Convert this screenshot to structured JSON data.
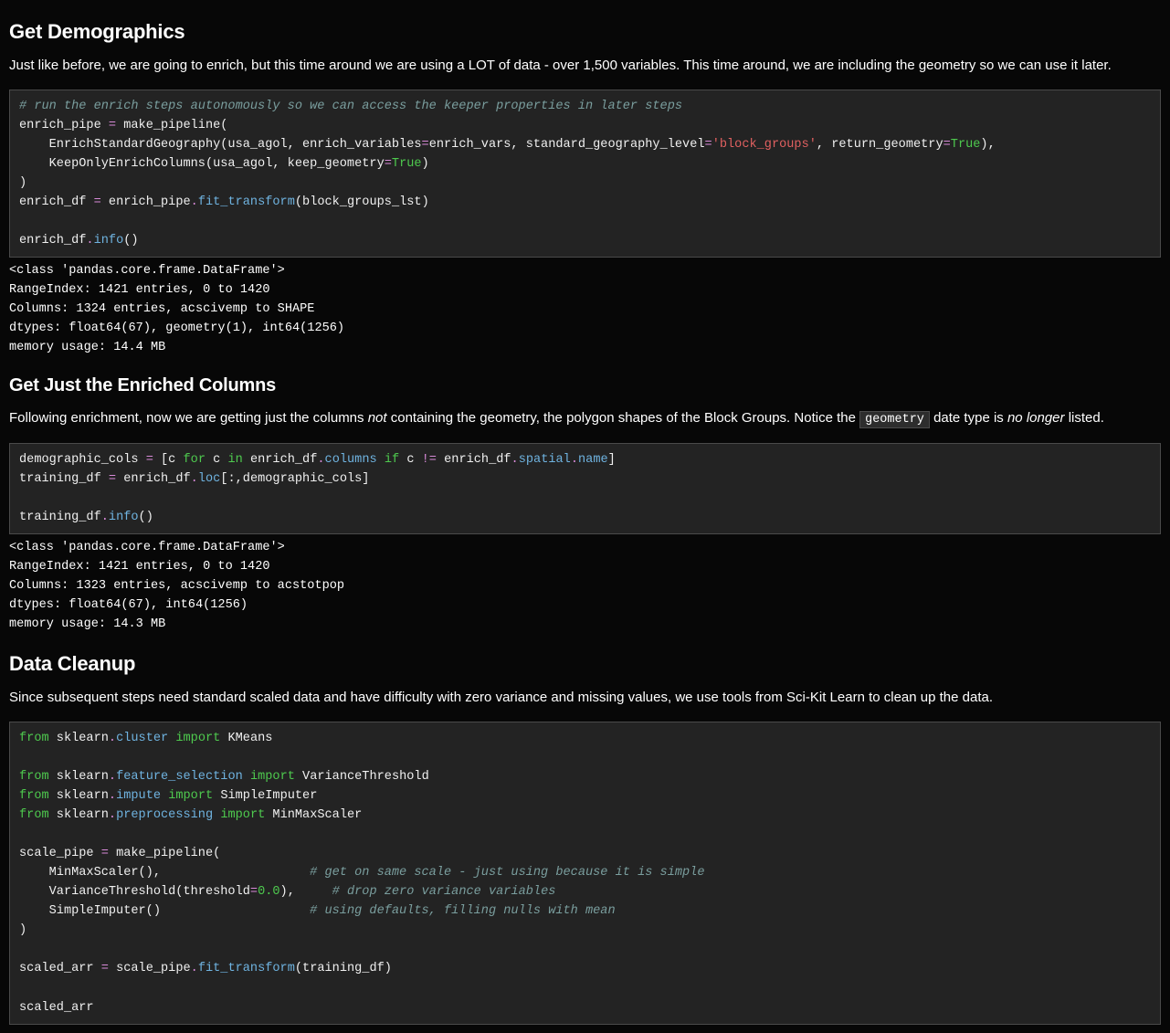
{
  "sections": {
    "demographics": {
      "heading": "Get Demographics",
      "prose": "Just like before, we are going to enrich, but this time around we are using a LOT of data - over 1,500 variables. This time around, we are including the geometry so we can use it later."
    },
    "enriched_cols": {
      "heading": "Get Just the Enriched Columns",
      "prose_pre": "Following enrichment, now we are getting just the columns ",
      "prose_em1": "not",
      "prose_mid": " containing the geometry, the polygon shapes of the Block Groups. Notice the ",
      "prose_code": "geometry",
      "prose_post1": " date type is ",
      "prose_em2": "no longer",
      "prose_post2": " listed."
    },
    "cleanup": {
      "heading": "Data Cleanup",
      "prose": "Since subsequent steps need standard scaled data and have difficulty with zero variance and missing values, we use tools from Sci-Kit Learn to clean up the data."
    }
  },
  "code": {
    "c1_comment": "# run the enrich steps autonomously so we can access the keeper properties in later steps",
    "c1_l1a": "enrich_pipe ",
    "c1_l1b": " make_pipeline(",
    "c1_l2a": "    EnrichStandardGeography(usa_agol, enrich_variables",
    "c1_l2b": "enrich_vars, standard_geography_level",
    "c1_l2c": "'block_groups'",
    "c1_l2d": ", return_geometry",
    "c1_l2e": "True",
    "c1_l2f": "),",
    "c1_l3a": "    KeepOnlyEnrichColumns(usa_agol, keep_geometry",
    "c1_l3b": "True",
    "c1_l3c": ")",
    "c1_l4": ")",
    "c1_l5a": "enrich_df ",
    "c1_l5b": " enrich_pipe",
    "c1_l5c": "fit_transform",
    "c1_l5d": "(block_groups_lst)",
    "c1_l6a": "enrich_df",
    "c1_l6b": "info",
    "c1_l6c": "()",
    "out1_l1": "<class 'pandas.core.frame.DataFrame'>",
    "out1_l2": "RangeIndex: 1421 entries, 0 to 1420",
    "out1_l3": "Columns: 1324 entries, acscivemp to SHAPE",
    "out1_l4": "dtypes: float64(67), geometry(1), int64(1256)",
    "out1_l5": "memory usage: 14.4 MB",
    "c2_l1a": "demographic_cols ",
    "c2_l1b": " [c ",
    "c2_l1c": "for",
    "c2_l1d": " c ",
    "c2_l1e": "in",
    "c2_l1f": " enrich_df",
    "c2_l1g": "columns",
    "c2_l1h": " ",
    "c2_l1i": "if",
    "c2_l1j": " c ",
    "c2_l1k": "!=",
    "c2_l1l": " enrich_df",
    "c2_l1m": "spatial",
    "c2_l1n": "name",
    "c2_l1o": "]",
    "c2_l2a": "training_df ",
    "c2_l2b": " enrich_df",
    "c2_l2c": "loc",
    "c2_l2d": "[:,demographic_cols]",
    "c2_l3a": "training_df",
    "c2_l3b": "info",
    "c2_l3c": "()",
    "out2_l1": "<class 'pandas.core.frame.DataFrame'>",
    "out2_l2": "RangeIndex: 1421 entries, 0 to 1420",
    "out2_l3": "Columns: 1323 entries, acscivemp to acstotpop",
    "out2_l4": "dtypes: float64(67), int64(1256)",
    "out2_l5": "memory usage: 14.3 MB",
    "c3_from": "from",
    "c3_import": "import",
    "c3_l1a": " sklearn",
    "c3_l1b": "cluster",
    "c3_l1c": " KMeans",
    "c3_l2b": "feature_selection",
    "c3_l2c": " VarianceThreshold",
    "c3_l3b": "impute",
    "c3_l3c": " SimpleImputer",
    "c3_l4b": "preprocessing",
    "c3_l4c": " MinMaxScaler",
    "c3_l5a": "scale_pipe ",
    "c3_l5b": " make_pipeline(",
    "c3_l6a": "    MinMaxScaler(),                    ",
    "c3_l6c": "# get on same scale - just using because it is simple",
    "c3_l7a": "    VarianceThreshold(threshold",
    "c3_l7b": "0.0",
    "c3_l7c": "),     ",
    "c3_l7d": "# drop zero variance variables",
    "c3_l8a": "    SimpleImputer()                    ",
    "c3_l8c": "# using defaults, filling nulls with mean",
    "c3_l9": ")",
    "c3_l10a": "scaled_arr ",
    "c3_l10b": " scale_pipe",
    "c3_l10c": "fit_transform",
    "c3_l10d": "(training_df)",
    "c3_l11": "scaled_arr"
  },
  "eq": "=",
  "dot": "."
}
